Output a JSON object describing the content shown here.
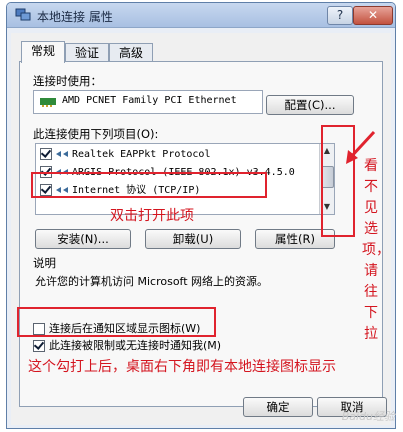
{
  "window": {
    "title": "本地连接 属性",
    "help_button": "?",
    "close_button": "✕"
  },
  "tabs": [
    "常规",
    "验证",
    "高级"
  ],
  "connect_using": {
    "label": "连接时使用：",
    "adapter": "AMD PCNET Family PCI Ethernet",
    "configure_button": "配置(C)..."
  },
  "items": {
    "label": "此连接使用下列项目(O):",
    "list": [
      {
        "checked": true,
        "text": "Realtek EAPPkt Protocol"
      },
      {
        "checked": true,
        "text": "ARGIS Protocol (IEEE 802.1x) v3.4.5.0"
      },
      {
        "checked": true,
        "text": "Internet 协议 (TCP/IP)"
      }
    ]
  },
  "buttons": {
    "install": "安装(N)...",
    "uninstall": "卸载(U)",
    "properties": "属性(R)"
  },
  "description": {
    "heading": "说明",
    "text": "允许您的计算机访问 Microsoft 网络上的资源。"
  },
  "options": {
    "show_icon": "连接后在通知区域显示图标(W)",
    "notify_limited": "此连接被限制或无连接时通知我(M)"
  },
  "footer": {
    "ok": "确定",
    "cancel": "取消"
  },
  "annotations": {
    "double_click": "双击打开此项",
    "scroll_hint": "看不见选项，请往下拉",
    "bottom_note": "这个勾打上后，桌面右下角即有本地连接图标显示"
  },
  "watermark": "Baidu经验",
  "colors": {
    "annotation_red": "#e0232e",
    "title_bar": "#a8c0e2"
  }
}
